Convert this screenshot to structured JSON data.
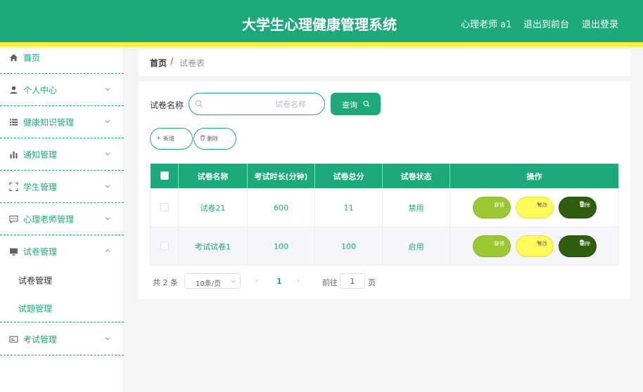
{
  "header": {
    "title": "大学生心理健康管理系统",
    "user": "心理老师 a1",
    "to_front": "退出到前台",
    "logout": "退出登录"
  },
  "sidebar": {
    "items": [
      {
        "label": "首页",
        "icon": "home-icon"
      },
      {
        "label": "个人中心",
        "icon": "user-icon"
      },
      {
        "label": "健康知识管理",
        "icon": "list-icon"
      },
      {
        "label": "通知管理",
        "icon": "bar-chart-icon"
      },
      {
        "label": "学生管理",
        "icon": "scan-icon"
      },
      {
        "label": "心理老师管理",
        "icon": "chat-icon"
      },
      {
        "label": "试卷管理",
        "icon": "monitor-icon"
      },
      {
        "label": "考试管理",
        "icon": "card-icon"
      }
    ],
    "sub_items": [
      {
        "label": "试卷管理",
        "active": true
      },
      {
        "label": "试题管理",
        "active": false
      }
    ]
  },
  "breadcrumb": {
    "home": "首页",
    "separator": "/",
    "current": "试卷表"
  },
  "search": {
    "label": "试卷名称",
    "placeholder": "试卷名称",
    "button": "查询"
  },
  "actions": {
    "add": "新增",
    "delete": "删除"
  },
  "table": {
    "columns": [
      "试卷名称",
      "考试时长(分钟)",
      "试卷总分",
      "试卷状态",
      "操作"
    ],
    "rows": [
      {
        "name": "试卷21",
        "duration": "600",
        "score": "11",
        "status": "禁用"
      },
      {
        "name": "考试试卷1",
        "duration": "100",
        "score": "100",
        "status": "启用"
      }
    ],
    "row_actions": {
      "detail": "详情",
      "edit": "修改",
      "delete": "删除"
    }
  },
  "pagination": {
    "total": "共 2 条",
    "page_size": "10条/页",
    "prev": "‹",
    "current_page": "1",
    "next": "›",
    "goto_label": "前往",
    "goto_value": "1",
    "page_suffix": "页"
  },
  "colors": {
    "primary": "#1ea97c",
    "header_strip": "#f5f14c",
    "detail": "#9bc832",
    "edit": "#fffa5c",
    "delete": "#2e5e0e"
  }
}
